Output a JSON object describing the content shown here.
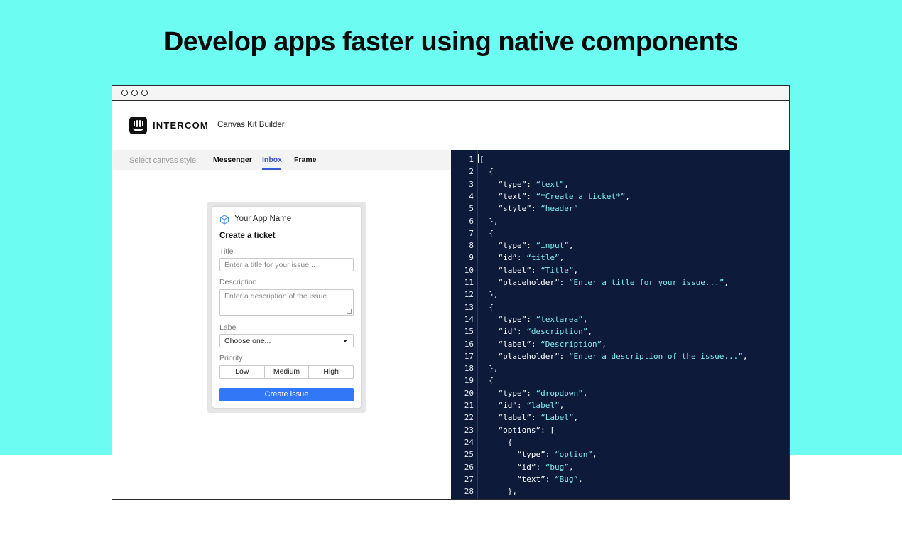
{
  "headline": "Develop apps faster using native components",
  "app_header": {
    "brand": "INTERCOM",
    "product": "Canvas Kit Builder"
  },
  "style_bar": {
    "label": "Select canvas style:",
    "options": [
      "Messenger",
      "Inbox",
      "Frame"
    ],
    "selected": "Inbox"
  },
  "card": {
    "app_name": "Your App Name",
    "heading": "Create a ticket",
    "title_label": "Title",
    "title_placeholder": "Enter a title for your issue...",
    "description_label": "Description",
    "description_placeholder": "Enter a description of the issue...",
    "label_label": "Label",
    "label_value": "Choose one...",
    "priority_label": "Priority",
    "priority_options": [
      "Low",
      "Medium",
      "High"
    ],
    "submit": "Create issue"
  },
  "code_lines": [
    [
      {
        "t": "["
      }
    ],
    [
      {
        "t": "  {"
      }
    ],
    [
      {
        "t": "    “type”: "
      },
      {
        "s": "“text”"
      },
      {
        "t": ","
      }
    ],
    [
      {
        "t": "    “text”: "
      },
      {
        "s": "“*Create a ticket*”"
      },
      {
        "t": ","
      }
    ],
    [
      {
        "t": "    “style”: "
      },
      {
        "s": "“header”"
      }
    ],
    [
      {
        "t": "  },"
      }
    ],
    [
      {
        "t": "  {"
      }
    ],
    [
      {
        "t": "    “type”: "
      },
      {
        "s": "“input”"
      },
      {
        "t": ","
      }
    ],
    [
      {
        "t": "    “id”: "
      },
      {
        "s": "“title”"
      },
      {
        "t": ","
      }
    ],
    [
      {
        "t": "    “label”: "
      },
      {
        "s": "“Title”"
      },
      {
        "t": ","
      }
    ],
    [
      {
        "t": "    “placeholder”: "
      },
      {
        "s": "“Enter a title for your issue...”"
      },
      {
        "t": ","
      }
    ],
    [
      {
        "t": "  },"
      }
    ],
    [
      {
        "t": "  {"
      }
    ],
    [
      {
        "t": "    “type”: "
      },
      {
        "s": "“textarea”"
      },
      {
        "t": ","
      }
    ],
    [
      {
        "t": "    “id”: "
      },
      {
        "s": "“description”"
      },
      {
        "t": ","
      }
    ],
    [
      {
        "t": "    “label”: "
      },
      {
        "s": "“Description”"
      },
      {
        "t": ","
      }
    ],
    [
      {
        "t": "    “placeholder”: "
      },
      {
        "s": "“Enter a description of the issue...”"
      },
      {
        "t": ","
      }
    ],
    [
      {
        "t": "  },"
      }
    ],
    [
      {
        "t": "  {"
      }
    ],
    [
      {
        "t": "    “type”: "
      },
      {
        "s": "“dropdown”"
      },
      {
        "t": ","
      }
    ],
    [
      {
        "t": "    “id”: "
      },
      {
        "s": "“label”"
      },
      {
        "t": ","
      }
    ],
    [
      {
        "t": "    “label”: "
      },
      {
        "s": "“Label”"
      },
      {
        "t": ","
      }
    ],
    [
      {
        "t": "    “options”: ["
      }
    ],
    [
      {
        "t": "      {"
      }
    ],
    [
      {
        "t": "        “type”: "
      },
      {
        "s": "“option”"
      },
      {
        "t": ","
      }
    ],
    [
      {
        "t": "        “id”: "
      },
      {
        "s": "“bug”"
      },
      {
        "t": ","
      }
    ],
    [
      {
        "t": "        “text”: "
      },
      {
        "s": "“Bug”"
      },
      {
        "t": ","
      }
    ],
    [
      {
        "t": "      },"
      }
    ]
  ],
  "line_numbers": [
    "1",
    "2",
    "3",
    "4",
    "5",
    "6",
    "7",
    "8",
    "9",
    "10",
    "11",
    "12",
    "13",
    "14",
    "15",
    "16",
    "17",
    "18",
    "19",
    "20",
    "21",
    "22",
    "23",
    "24",
    "25",
    "26",
    "27",
    "28"
  ],
  "colors": {
    "background": "#6cfcf2",
    "code_bg": "#0d1a3a",
    "code_string": "#7fe9ef",
    "accent_blue": "#3277f5",
    "tab_active": "#3a59d6"
  }
}
